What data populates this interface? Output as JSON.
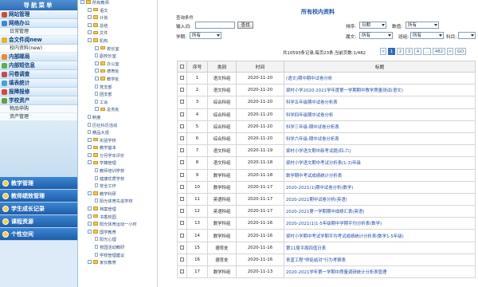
{
  "nav": {
    "title": "导航菜单",
    "items": [
      {
        "label": "网站管理",
        "color": "#d44a3a"
      },
      {
        "label": "网络办公",
        "color": "#3b8ad8"
      },
      {
        "label": "日常管理",
        "sub": true
      },
      {
        "label": "会文件阅new",
        "color": "#e6b32c"
      },
      {
        "label": "校内资料(new)",
        "sub": true,
        "sel": true
      },
      {
        "label": "内部邮局",
        "color": "#e98a2c"
      },
      {
        "label": "内部短信息",
        "color": "#5bb14a"
      },
      {
        "label": "问卷调查",
        "color": "#c0504d"
      },
      {
        "label": "填表统计",
        "color": "#4aa0d8"
      },
      {
        "label": "报障报修",
        "color": "#e0413a"
      },
      {
        "label": "学校资产",
        "color": "#6a9e3c"
      },
      {
        "label": "物品申购",
        "sub": true
      },
      {
        "label": "资产管理",
        "sub": true
      }
    ],
    "big": [
      "教学管理",
      "教师绩效管理",
      "学生成长记录",
      "课程资源",
      "个性空间"
    ]
  },
  "tree": {
    "rows": [
      {
        "t": "所有教师",
        "lv": 0,
        "k": "ti"
      },
      {
        "t": "语文",
        "lv": 1,
        "k": "ti"
      },
      {
        "t": "计划",
        "lv": 1,
        "k": "ti"
      },
      {
        "t": "总结",
        "lv": 1,
        "k": "ti"
      },
      {
        "t": "文件",
        "lv": 1,
        "k": "ti"
      },
      {
        "t": "机构",
        "lv": 1,
        "k": "ti"
      },
      {
        "t": "校长室",
        "lv": 2,
        "k": "ti"
      },
      {
        "t": "副校长室",
        "lv": 2,
        "k": "pi"
      },
      {
        "t": "办公室",
        "lv": 2,
        "k": "ti"
      },
      {
        "t": "德育处",
        "lv": 2,
        "k": "ti"
      },
      {
        "t": "教学处",
        "lv": 2,
        "k": "ti"
      },
      {
        "t": "党支部",
        "lv": 2,
        "k": "pi"
      },
      {
        "t": "团支部",
        "lv": 2,
        "k": "pi"
      },
      {
        "t": "工会",
        "lv": 2,
        "k": "pi"
      },
      {
        "t": "总务处",
        "lv": 2,
        "k": "ti"
      },
      {
        "t": "制度",
        "lv": 1,
        "k": "pi"
      },
      {
        "t": "历社科历活动",
        "lv": 1,
        "k": "pi"
      },
      {
        "t": "精品大观",
        "lv": 1,
        "k": "pi"
      },
      {
        "t": "实验学校",
        "lv": 1,
        "k": "ti"
      },
      {
        "t": "教学基本",
        "lv": 1,
        "k": "ti"
      },
      {
        "t": "分月学年评价",
        "lv": 1,
        "k": "ti"
      },
      {
        "t": "学籍管理",
        "lv": 1,
        "k": "ti"
      },
      {
        "t": "教师培训学校",
        "lv": 2,
        "k": "pi"
      },
      {
        "t": "健康优质学校",
        "lv": 2,
        "k": "pi"
      },
      {
        "t": "安全工作",
        "lv": 2,
        "k": "pi"
      },
      {
        "t": "教学科研",
        "lv": 1,
        "k": "ti"
      },
      {
        "t": "阳光体育先进学校",
        "lv": 2,
        "k": "pi"
      },
      {
        "t": "档案管理",
        "lv": 1,
        "k": "ti"
      },
      {
        "t": "书香校园",
        "lv": 1,
        "k": "ti"
      },
      {
        "t": "阳光体育运动一小时",
        "lv": 1,
        "k": "ti"
      },
      {
        "t": "国学教育",
        "lv": 1,
        "k": "ti"
      },
      {
        "t": "阳光心理",
        "lv": 2,
        "k": "pi"
      },
      {
        "t": "校园活动教研",
        "lv": 2,
        "k": "pi"
      },
      {
        "t": "学校管理建议",
        "lv": 2,
        "k": "pi"
      },
      {
        "t": "家长教育",
        "lv": 1,
        "k": "ti"
      }
    ]
  },
  "main": {
    "page_title": "所有校内资料",
    "search_title": "查询条件",
    "f_input_label": "输入词:",
    "f_search_btn": "查找",
    "f_subject_label": "学期:",
    "f_subject_val": "所有",
    "f_sort_label": "排序:",
    "f_sort_val": "日期",
    "f_order_label": "数值:",
    "f_order_val": "所有",
    "f_type_label": "属文:",
    "f_type_val": "所有",
    "f_teacher_label": "班组:",
    "f_teacher_val": "所有",
    "f_year_label": "科目:",
    "pager_info": "共10593条记录,每页23条,当前页数:1/482",
    "pages": [
      "<",
      "1",
      "2",
      "3",
      "4",
      "…",
      "482",
      ">",
      "GO"
    ],
    "headers": [
      "序号",
      "类别",
      "时间",
      "标题"
    ],
    "rows": [
      [
        "1",
        "语文科组",
        "2020-11-20",
        "(语文)期中期中试卷分析"
      ],
      [
        "2",
        "语文科组",
        "2020-11-20",
        "梁村小学2020-2021学年度第一学期期中教学质量测试(语文)"
      ],
      [
        "3",
        "综合科组",
        "2020-11-20",
        "科学五年级期中试卷分析表"
      ],
      [
        "4",
        "综合科组",
        "2020-11-20",
        "科学四年级期中试卷分析"
      ],
      [
        "5",
        "综合科组",
        "2020-11-20",
        "科学三年级-期中试卷分析表"
      ],
      [
        "6",
        "综合科组",
        "2020-11-20",
        "科学六年级-期中试卷分析表"
      ],
      [
        "7",
        "语文科组",
        "2020-11-19",
        "梁村小学语文期中新考试题(四-六)"
      ],
      [
        "8",
        "语文科组",
        "2020-11-18",
        "梁村小学语文期中考试分析表(1-3)年级"
      ],
      [
        "9",
        "数学科组",
        "2020-11-18",
        "数学期中考试成绩统计分析表"
      ],
      [
        "10",
        "数学科组",
        "2020-11-17",
        "2020-2021(1)期中试卷分析(数学)"
      ],
      [
        "11",
        "英语科组",
        "2020-11-17",
        "2020-2021期中试卷分析(英语)"
      ],
      [
        "12",
        "英语科组",
        "2020-11-17",
        "2020-2021第一学期期中成绩汇表(英语)"
      ],
      [
        "13",
        "数学科组",
        "2020-11-16",
        "2020-2021(1)1-5年级期中学期平均分析表(数学)"
      ],
      [
        "14",
        "数学科组",
        "2020-11-16",
        "梁村小学期中考试学期平均考试成绩统计分析表(数学1-5年级)"
      ],
      [
        "15",
        "德育处",
        "2020-11-16",
        "第11周平周四值日表"
      ],
      [
        "16",
        "德育处",
        "2020-11-16",
        "青蓝工程\"师徒结对\"行为考察表"
      ],
      [
        "17",
        "数学科组",
        "2020-11-13",
        "2020-2021学年第一学期中质量调研统计分析表管理"
      ]
    ]
  }
}
